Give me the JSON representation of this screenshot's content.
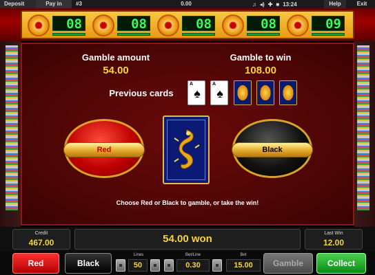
{
  "topbar": {
    "deposit": "Deposit",
    "payin": "Pay in",
    "round": "#3",
    "balance": "0.00",
    "time": "13:24",
    "help": "Help",
    "exit": "Exit"
  },
  "jackpot": {
    "counters": [
      "08",
      "08",
      "08",
      "08",
      "09"
    ]
  },
  "gamble": {
    "amount_label": "Gamble amount",
    "amount_value": "54.00",
    "win_label": "Gamble to win",
    "win_value": "108.00",
    "previous_label": "Previous cards",
    "previous_cards": [
      {
        "rank": "A",
        "suit": "♠"
      },
      {
        "rank": "A",
        "suit": "♠"
      },
      {
        "rank": "",
        "suit": ""
      },
      {
        "rank": "",
        "suit": ""
      },
      {
        "rank": "",
        "suit": ""
      }
    ],
    "red_label": "Red",
    "black_label": "Black",
    "hint": "Choose Red or Black to gamble, or take the win!"
  },
  "info": {
    "credit_label": "Credit",
    "credit_value": "467.00",
    "won_text": "54.00 won",
    "lastwin_label": "Last Win",
    "lastwin_value": "12.00"
  },
  "controls": {
    "red": "Red",
    "black": "Black",
    "lines_label": "Lines",
    "lines_value": "50",
    "betline_label": "Bet/Line",
    "betline_value": "0.30",
    "bet_label": "Bet",
    "bet_value": "15.00",
    "gamble": "Gamble",
    "collect": "Collect"
  },
  "colors": {
    "accent_yellow": "#f5d53a",
    "jackpot_green": "#37ff5a",
    "panel_red": "#6a0a0a"
  }
}
